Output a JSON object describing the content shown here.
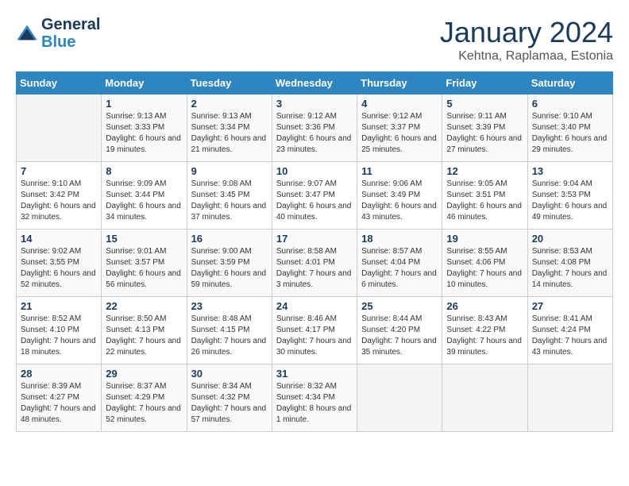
{
  "header": {
    "logo_line1": "General",
    "logo_line2": "Blue",
    "month": "January 2024",
    "location": "Kehtna, Raplamaa, Estonia"
  },
  "weekdays": [
    "Sunday",
    "Monday",
    "Tuesday",
    "Wednesday",
    "Thursday",
    "Friday",
    "Saturday"
  ],
  "weeks": [
    [
      {
        "day": "",
        "sunrise": "",
        "sunset": "",
        "daylight": ""
      },
      {
        "day": "1",
        "sunrise": "Sunrise: 9:13 AM",
        "sunset": "Sunset: 3:33 PM",
        "daylight": "Daylight: 6 hours and 19 minutes."
      },
      {
        "day": "2",
        "sunrise": "Sunrise: 9:13 AM",
        "sunset": "Sunset: 3:34 PM",
        "daylight": "Daylight: 6 hours and 21 minutes."
      },
      {
        "day": "3",
        "sunrise": "Sunrise: 9:12 AM",
        "sunset": "Sunset: 3:36 PM",
        "daylight": "Daylight: 6 hours and 23 minutes."
      },
      {
        "day": "4",
        "sunrise": "Sunrise: 9:12 AM",
        "sunset": "Sunset: 3:37 PM",
        "daylight": "Daylight: 6 hours and 25 minutes."
      },
      {
        "day": "5",
        "sunrise": "Sunrise: 9:11 AM",
        "sunset": "Sunset: 3:39 PM",
        "daylight": "Daylight: 6 hours and 27 minutes."
      },
      {
        "day": "6",
        "sunrise": "Sunrise: 9:10 AM",
        "sunset": "Sunset: 3:40 PM",
        "daylight": "Daylight: 6 hours and 29 minutes."
      }
    ],
    [
      {
        "day": "7",
        "sunrise": "Sunrise: 9:10 AM",
        "sunset": "Sunset: 3:42 PM",
        "daylight": "Daylight: 6 hours and 32 minutes."
      },
      {
        "day": "8",
        "sunrise": "Sunrise: 9:09 AM",
        "sunset": "Sunset: 3:44 PM",
        "daylight": "Daylight: 6 hours and 34 minutes."
      },
      {
        "day": "9",
        "sunrise": "Sunrise: 9:08 AM",
        "sunset": "Sunset: 3:45 PM",
        "daylight": "Daylight: 6 hours and 37 minutes."
      },
      {
        "day": "10",
        "sunrise": "Sunrise: 9:07 AM",
        "sunset": "Sunset: 3:47 PM",
        "daylight": "Daylight: 6 hours and 40 minutes."
      },
      {
        "day": "11",
        "sunrise": "Sunrise: 9:06 AM",
        "sunset": "Sunset: 3:49 PM",
        "daylight": "Daylight: 6 hours and 43 minutes."
      },
      {
        "day": "12",
        "sunrise": "Sunrise: 9:05 AM",
        "sunset": "Sunset: 3:51 PM",
        "daylight": "Daylight: 6 hours and 46 minutes."
      },
      {
        "day": "13",
        "sunrise": "Sunrise: 9:04 AM",
        "sunset": "Sunset: 3:53 PM",
        "daylight": "Daylight: 6 hours and 49 minutes."
      }
    ],
    [
      {
        "day": "14",
        "sunrise": "Sunrise: 9:02 AM",
        "sunset": "Sunset: 3:55 PM",
        "daylight": "Daylight: 6 hours and 52 minutes."
      },
      {
        "day": "15",
        "sunrise": "Sunrise: 9:01 AM",
        "sunset": "Sunset: 3:57 PM",
        "daylight": "Daylight: 6 hours and 56 minutes."
      },
      {
        "day": "16",
        "sunrise": "Sunrise: 9:00 AM",
        "sunset": "Sunset: 3:59 PM",
        "daylight": "Daylight: 6 hours and 59 minutes."
      },
      {
        "day": "17",
        "sunrise": "Sunrise: 8:58 AM",
        "sunset": "Sunset: 4:01 PM",
        "daylight": "Daylight: 7 hours and 3 minutes."
      },
      {
        "day": "18",
        "sunrise": "Sunrise: 8:57 AM",
        "sunset": "Sunset: 4:04 PM",
        "daylight": "Daylight: 7 hours and 6 minutes."
      },
      {
        "day": "19",
        "sunrise": "Sunrise: 8:55 AM",
        "sunset": "Sunset: 4:06 PM",
        "daylight": "Daylight: 7 hours and 10 minutes."
      },
      {
        "day": "20",
        "sunrise": "Sunrise: 8:53 AM",
        "sunset": "Sunset: 4:08 PM",
        "daylight": "Daylight: 7 hours and 14 minutes."
      }
    ],
    [
      {
        "day": "21",
        "sunrise": "Sunrise: 8:52 AM",
        "sunset": "Sunset: 4:10 PM",
        "daylight": "Daylight: 7 hours and 18 minutes."
      },
      {
        "day": "22",
        "sunrise": "Sunrise: 8:50 AM",
        "sunset": "Sunset: 4:13 PM",
        "daylight": "Daylight: 7 hours and 22 minutes."
      },
      {
        "day": "23",
        "sunrise": "Sunrise: 8:48 AM",
        "sunset": "Sunset: 4:15 PM",
        "daylight": "Daylight: 7 hours and 26 minutes."
      },
      {
        "day": "24",
        "sunrise": "Sunrise: 8:46 AM",
        "sunset": "Sunset: 4:17 PM",
        "daylight": "Daylight: 7 hours and 30 minutes."
      },
      {
        "day": "25",
        "sunrise": "Sunrise: 8:44 AM",
        "sunset": "Sunset: 4:20 PM",
        "daylight": "Daylight: 7 hours and 35 minutes."
      },
      {
        "day": "26",
        "sunrise": "Sunrise: 8:43 AM",
        "sunset": "Sunset: 4:22 PM",
        "daylight": "Daylight: 7 hours and 39 minutes."
      },
      {
        "day": "27",
        "sunrise": "Sunrise: 8:41 AM",
        "sunset": "Sunset: 4:24 PM",
        "daylight": "Daylight: 7 hours and 43 minutes."
      }
    ],
    [
      {
        "day": "28",
        "sunrise": "Sunrise: 8:39 AM",
        "sunset": "Sunset: 4:27 PM",
        "daylight": "Daylight: 7 hours and 48 minutes."
      },
      {
        "day": "29",
        "sunrise": "Sunrise: 8:37 AM",
        "sunset": "Sunset: 4:29 PM",
        "daylight": "Daylight: 7 hours and 52 minutes."
      },
      {
        "day": "30",
        "sunrise": "Sunrise: 8:34 AM",
        "sunset": "Sunset: 4:32 PM",
        "daylight": "Daylight: 7 hours and 57 minutes."
      },
      {
        "day": "31",
        "sunrise": "Sunrise: 8:32 AM",
        "sunset": "Sunset: 4:34 PM",
        "daylight": "Daylight: 8 hours and 1 minute."
      },
      {
        "day": "",
        "sunrise": "",
        "sunset": "",
        "daylight": ""
      },
      {
        "day": "",
        "sunrise": "",
        "sunset": "",
        "daylight": ""
      },
      {
        "day": "",
        "sunrise": "",
        "sunset": "",
        "daylight": ""
      }
    ]
  ]
}
